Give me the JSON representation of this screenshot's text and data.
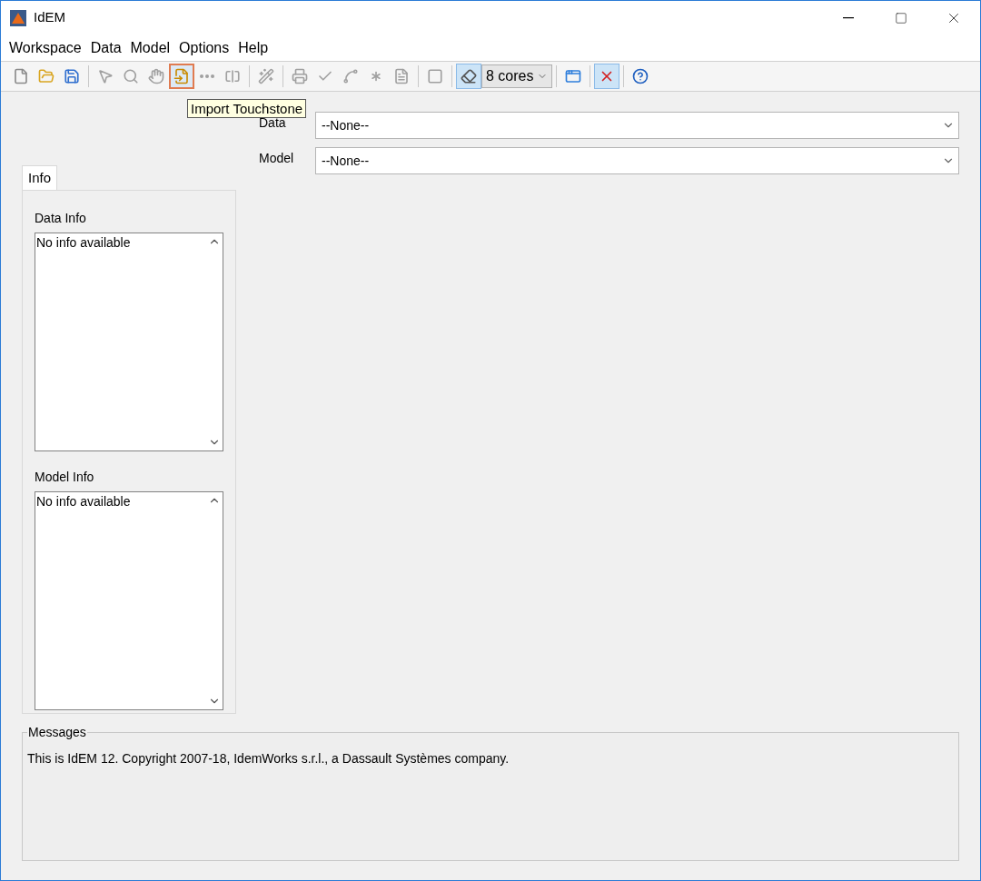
{
  "window": {
    "title": "IdEM"
  },
  "menu": [
    "Workspace",
    "Data",
    "Model",
    "Options",
    "Help"
  ],
  "toolbar": [
    {
      "kind": "button",
      "disabled": false,
      "pressed": false,
      "highlighted": false
    },
    {
      "kind": "button",
      "disabled": false,
      "pressed": false,
      "highlighted": false
    },
    {
      "kind": "button",
      "disabled": false,
      "pressed": false,
      "highlighted": false
    },
    {
      "kind": "separator"
    },
    {
      "kind": "button",
      "disabled": true,
      "pressed": false,
      "highlighted": false
    },
    {
      "kind": "button",
      "disabled": true,
      "pressed": false,
      "highlighted": false
    },
    {
      "kind": "button",
      "disabled": true,
      "pressed": false,
      "highlighted": false
    },
    {
      "kind": "button",
      "disabled": false,
      "pressed": false,
      "highlighted": true
    },
    {
      "kind": "button",
      "disabled": true,
      "pressed": false,
      "highlighted": false
    },
    {
      "kind": "button",
      "disabled": true,
      "pressed": false,
      "highlighted": false
    },
    {
      "kind": "separator"
    },
    {
      "kind": "button",
      "disabled": true,
      "pressed": false,
      "highlighted": false
    },
    {
      "kind": "separator"
    },
    {
      "kind": "button",
      "disabled": true,
      "pressed": false,
      "highlighted": false
    },
    {
      "kind": "button",
      "disabled": true,
      "pressed": false,
      "highlighted": false
    },
    {
      "kind": "button",
      "disabled": true,
      "pressed": false,
      "highlighted": false
    },
    {
      "kind": "button",
      "disabled": true,
      "pressed": false,
      "highlighted": false
    },
    {
      "kind": "button",
      "disabled": true,
      "pressed": false,
      "highlighted": false
    },
    {
      "kind": "separator"
    },
    {
      "kind": "button",
      "disabled": true,
      "pressed": false,
      "highlighted": false
    },
    {
      "kind": "separator"
    },
    {
      "kind": "button",
      "disabled": false,
      "pressed": true,
      "highlighted": false
    },
    {
      "kind": "dropdown",
      "value": "8 cores"
    },
    {
      "kind": "separator"
    },
    {
      "kind": "button",
      "disabled": false,
      "pressed": false,
      "highlighted": false
    },
    {
      "kind": "separator"
    },
    {
      "kind": "button",
      "disabled": false,
      "pressed": true,
      "highlighted": false
    },
    {
      "kind": "separator"
    },
    {
      "kind": "button",
      "disabled": false,
      "pressed": false,
      "highlighted": false
    }
  ],
  "tooltip": "Import Touchstone",
  "selectors": [
    {
      "label": "Data",
      "value": "--None--"
    },
    {
      "label": "Model",
      "value": "--None--"
    }
  ],
  "tabs": [
    {
      "label": "Info",
      "selected": true
    }
  ],
  "info_boxes": [
    {
      "label": "Data Info",
      "text": "No info available"
    },
    {
      "label": "Model Info",
      "text": "No info available"
    }
  ],
  "messages": {
    "title": "Messages",
    "text": "This is IdEM 12. Copyright 2007-18, IdemWorks s.r.l., a Dassault Systèmes company."
  }
}
